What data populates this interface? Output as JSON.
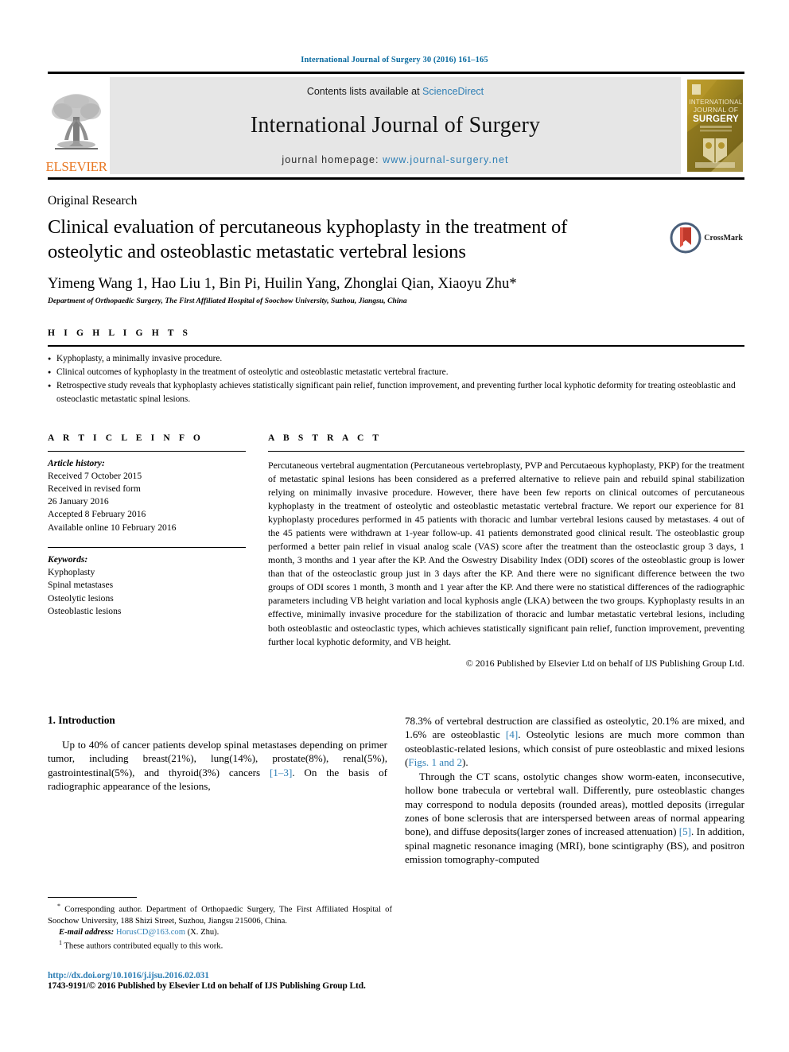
{
  "running_head": "International Journal of Surgery 30 (2016) 161–165",
  "masthead": {
    "contents_prefix": "Contents lists available at ",
    "sciencedirect": "ScienceDirect",
    "journal_title": "International Journal of Surgery",
    "homepage_prefix": "journal homepage: ",
    "homepage_url": "www.journal-surgery.net",
    "publisher_wordmark": "ELSEVIER",
    "cover_lines": [
      "INTERNATIONAL",
      "JOURNAL OF",
      "SURGERY"
    ],
    "link_color": "#2f7fb5",
    "elsevier_orange": "#E87722"
  },
  "article": {
    "type": "Original Research",
    "title": "Clinical evaluation of percutaneous kyphoplasty in the treatment of osteolytic and osteoblastic metastatic vertebral lesions",
    "crossmark_label": "CrossMark",
    "authors": "Yimeng Wang 1, Hao Liu 1, Bin Pi, Huilin Yang, Zhonglai Qian, Xiaoyu Zhu*",
    "affiliation": "Department of Orthopaedic Surgery, The First Affiliated Hospital of Soochow University, Suzhou, Jiangsu, China"
  },
  "highlights": {
    "label": "H I G H L I G H T S",
    "items": [
      "Kyphoplasty, a minimally invasive procedure.",
      "Clinical outcomes of kyphoplasty in the treatment of osteolytic and osteoblastic metastatic vertebral fracture.",
      "Retrospective study reveals that kyphoplasty achieves statistically significant pain relief, function improvement, and preventing further local kyphotic deformity for treating osteoblastic and osteoclastic metastatic spinal lesions."
    ]
  },
  "article_info": {
    "label": "A R T I C L E   I N F O",
    "history_label": "Article history:",
    "history": [
      "Received 7 October 2015",
      "Received in revised form",
      "26 January 2016",
      "Accepted 8 February 2016",
      "Available online 10 February 2016"
    ],
    "keywords_label": "Keywords:",
    "keywords": [
      "Kyphoplasty",
      "Spinal metastases",
      "Osteolytic lesions",
      "Osteoblastic lesions"
    ]
  },
  "abstract": {
    "label": "A B S T R A C T",
    "text": "Percutaneous vertebral augmentation (Percutaneous vertebroplasty, PVP and Percutaeous kyphoplasty, PKP) for the treatment of metastatic spinal lesions has been considered as a preferred alternative to relieve pain and rebuild spinal stabilization relying on minimally invasive procedure. However, there have been few reports on clinical outcomes of percutaneous kyphoplasty in the treatment of osteolytic and osteoblastic metastatic vertebral fracture. We report our experience for 81 kyphoplasty procedures performed in 45 patients with thoracic and lumbar vertebral lesions caused by metastases. 4 out of the 45 patients were withdrawn at 1-year follow-up. 41 patients demonstrated good clinical result. The osteoblastic group performed a better pain relief in visual analog scale (VAS) score after the treatment than the osteoclastic group 3 days, 1 month, 3 months and 1 year after the KP. And the Oswestry Disability Index (ODI) scores of the osteoblastic group is lower than that of the osteoclastic group just in 3 days after the KP. And there were no significant difference between the two groups of ODI scores 1 month, 3 month and 1 year after the KP. And there were no statistical differences of the radiographic parameters including VB height variation and local kyphosis angle (LKA) between the two groups. Kyphoplasty results in an effective, minimally invasive procedure for the stabilization of thoracic and lumbar metastatic vertebral lesions, including both osteoblastic and osteoclastic types, which achieves statistically significant pain relief, function improvement, preventing further local kyphotic deformity, and VB height.",
    "copyright": "© 2016 Published by Elsevier Ltd on behalf of IJS Publishing Group Ltd."
  },
  "body": {
    "section_heading": "1. Introduction",
    "left_paragraph_1_a": "Up to 40% of cancer patients develop spinal metastases depending on primer tumor, including breast(21%), lung(14%), prostate(8%), renal(5%), gastrointestinal(5%), and thyroid(3%) cancers ",
    "left_citation_1": "[1–3]",
    "left_paragraph_1_b": ". On the basis of radiographic appearance of the lesions,",
    "right_paragraph_1_a": "78.3% of vertebral destruction are classified as osteolytic, 20.1% are mixed, and 1.6% are osteoblastic ",
    "right_citation_1": "[4]",
    "right_paragraph_1_b": ". Osteolytic lesions are much more common than osteoblastic-related lesions, which consist of pure osteoblastic and mixed lesions (",
    "right_figref_1": "Figs. 1 and 2",
    "right_paragraph_1_c": ").",
    "right_paragraph_2_a": "Through the CT scans, ostolytic changes show worm-eaten, inconsecutive, hollow bone trabecula or vertebral wall. Differently, pure osteoblastic changes may correspond to nodula deposits (rounded areas), mottled deposits (irregular zones of bone sclerosis that are interspersed between areas of normal appearing bone), and diffuse deposits(larger zones of increased attenuation) ",
    "right_citation_2": "[5]",
    "right_paragraph_2_b": ". In addition, spinal magnetic resonance imaging (MRI), bone scintigraphy (BS), and positron emission tomography-computed"
  },
  "footnotes": {
    "corresponding_marker": "*",
    "corresponding": " Corresponding author. Department of Orthopaedic Surgery, The First Affiliated Hospital of Soochow University, 188 Shizi Street, Suzhou, Jiangsu 215006, China.",
    "email_label": "E-mail address:",
    "email": "HorusCD@163.com",
    "email_suffix": " (X. Zhu).",
    "equal_marker": "1",
    "equal_contrib": " These authors contributed equally to this work."
  },
  "footer": {
    "doi": "http://dx.doi.org/10.1016/j.ijsu.2016.02.031",
    "issn_line": "1743-9191/© 2016 Published by Elsevier Ltd on behalf of IJS Publishing Group Ltd."
  }
}
